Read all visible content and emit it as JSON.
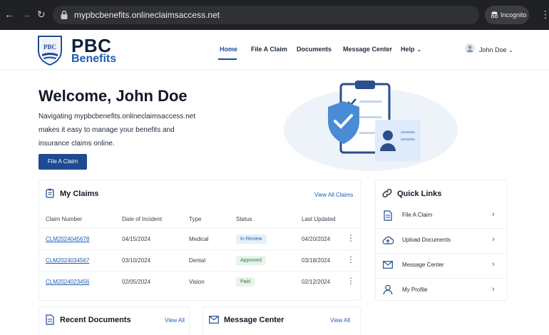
{
  "browser": {
    "url": "mypbcbenefits.onlineclaimsaccess.net",
    "incognito_label": "Incognito"
  },
  "brand": {
    "logo_text": "PBC",
    "name_line1": "PBC",
    "name_line2": "Benefits",
    "primary_color": "#1e4a91"
  },
  "nav": {
    "items": [
      "Home",
      "File A Claim",
      "Documents",
      "Message Center",
      "Help"
    ],
    "active": "Home",
    "user_name": "John Doe"
  },
  "hero": {
    "title": "Welcome, John Doe",
    "description": "Navigating mypbcbenefits.onlineclaimsaccess.net makes it easy to manage your benefits and insurance claims online.",
    "button_label": "File A Claim"
  },
  "claims": {
    "title": "My Claims",
    "view_all": "View All Claims",
    "columns": [
      "Claim Number",
      "Date of Incident",
      "Type",
      "Status",
      "Last Updated"
    ],
    "rows": [
      {
        "claim": "CLM2024045678",
        "date": "04/15/2024",
        "type": "Medical",
        "status": "In Review",
        "updated": "04/20/2024"
      },
      {
        "claim": "CLM2024034567",
        "date": "03/10/2024",
        "type": "Dental",
        "status": "Approved",
        "updated": "03/18/2024"
      },
      {
        "claim": "CLM2024023456",
        "date": "02/05/2024",
        "type": "Vision",
        "status": "Paid",
        "updated": "02/12/2024"
      }
    ]
  },
  "quick_links": {
    "title": "Quick Links",
    "items": [
      {
        "label": "File A Claim",
        "icon": "document-icon"
      },
      {
        "label": "Upload Documents",
        "icon": "cloud-upload-icon"
      },
      {
        "label": "Message Center",
        "icon": "envelope-icon"
      },
      {
        "label": "My Profile",
        "icon": "user-icon"
      }
    ]
  },
  "recent_documents": {
    "title": "Recent Documents",
    "view_all": "View All"
  },
  "message_center": {
    "title": "Message Center",
    "view_all": "View All"
  },
  "status_colors": {
    "In Review": {
      "bg": "#e6f0fb",
      "fg": "#2563a8"
    },
    "Approved": {
      "bg": "#e6f4ea",
      "fg": "#2f7a3e"
    },
    "Paid": {
      "bg": "#e6f4ea",
      "fg": "#2f7a3e"
    }
  }
}
